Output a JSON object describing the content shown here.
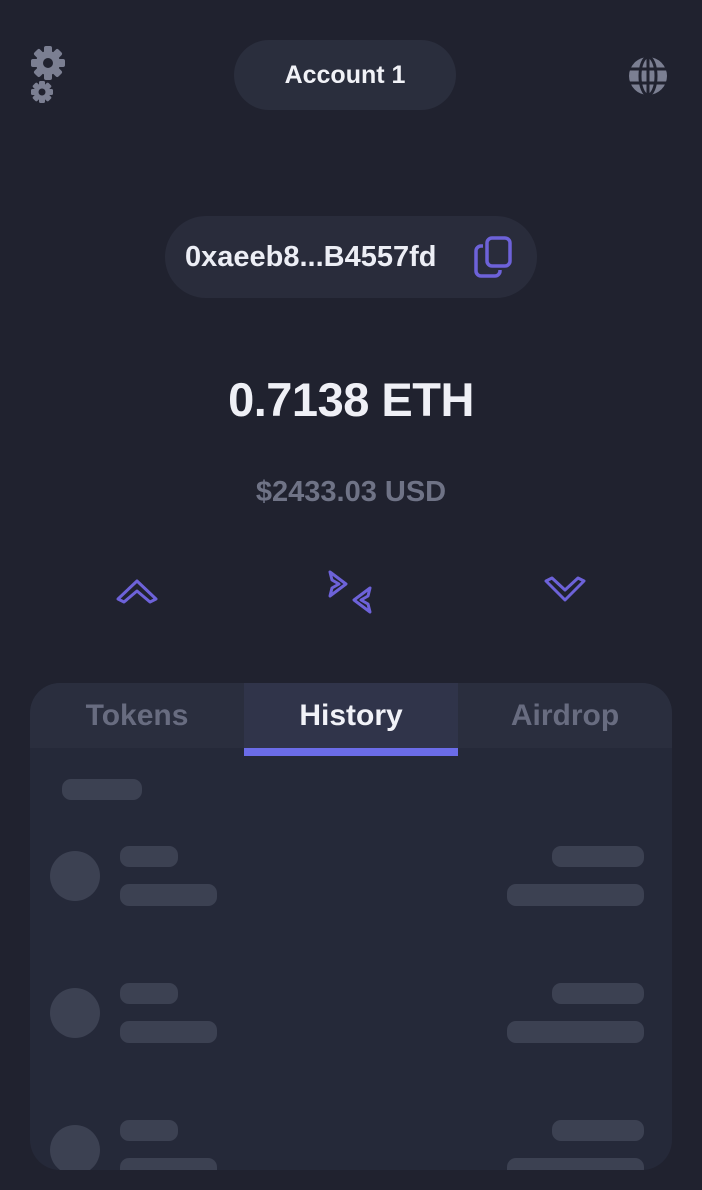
{
  "header": {
    "settings_icon": "gear-icon",
    "account_label": "Account 1",
    "network_icon": "globe-icon"
  },
  "wallet": {
    "address": "0xaeeb8...B4557fd",
    "copy_icon": "copy-icon",
    "balance": "0.7138 ETH",
    "fiat_value": "$2433.03 USD"
  },
  "actions": [
    {
      "name": "send",
      "icon": "chevron-up-icon"
    },
    {
      "name": "swap",
      "icon": "swap-arrows-icon"
    },
    {
      "name": "receive",
      "icon": "chevron-down-icon"
    }
  ],
  "tabs": [
    {
      "label": "Tokens",
      "active": false
    },
    {
      "label": "History",
      "active": true
    },
    {
      "label": "Airdrop",
      "active": false
    }
  ],
  "colors": {
    "background": "#20222f",
    "accent": "#6b6ce8",
    "pill": "#2a2e3d",
    "skeleton": "#3c4152"
  }
}
